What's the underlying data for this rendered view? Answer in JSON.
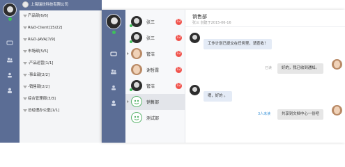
{
  "back_window": {
    "company": "上海瑞欣科技有限公司",
    "departments": [
      {
        "label": "产品部[6/6]"
      },
      {
        "label": "R&D-Client[15/22]"
      },
      {
        "label": "R&D-JAVA[7/9]"
      },
      {
        "label": "市场部[5/5]"
      },
      {
        "label": "-产品运营[1/1]"
      },
      {
        "label": "-事业部[2/2]"
      },
      {
        "label": "-销售部[2/2]"
      },
      {
        "label": "综合管理部[3/3]"
      },
      {
        "label": "总经理办公室[1/1]"
      }
    ]
  },
  "front_window": {
    "chats": [
      {
        "name": "张三",
        "badge": "12",
        "avatar": "dark"
      },
      {
        "name": "张三",
        "badge": "12",
        "avatar": "dark"
      },
      {
        "name": "管洁",
        "badge": "12",
        "avatar": "girl"
      },
      {
        "name": "谢哲露",
        "badge": "12",
        "avatar": "girl"
      },
      {
        "name": "管洁",
        "badge": "12",
        "avatar": "dark"
      },
      {
        "name": "销售部",
        "badge": "",
        "avatar": "group",
        "active": true
      },
      {
        "name": "测试部",
        "badge": "",
        "avatar": "group"
      }
    ],
    "conversation": {
      "title": "销售部",
      "subtitle": "张三 创建于2015-06-16",
      "messages": [
        {
          "side": "left",
          "text": "工作计划已提交在任务里，请查收！"
        },
        {
          "side": "right",
          "text": "好的，我已收到通知。",
          "status": "已读"
        },
        {
          "side": "left",
          "text": "嗯，好的 。"
        },
        {
          "side": "right",
          "text": "共享到文档中心一份吧",
          "status": "3人未读"
        }
      ]
    }
  },
  "colors": {
    "rail": "#5b6d95",
    "badge": "#f0524b",
    "online": "#3ec15a",
    "unread_link": "#3a93d8",
    "bubble_left": "#e4ebf6",
    "bubble_right": "#e6e6e6"
  },
  "icons": [
    "chat-icon",
    "contacts-icon",
    "group-icon",
    "person-icon",
    "group-avatar-icon"
  ]
}
